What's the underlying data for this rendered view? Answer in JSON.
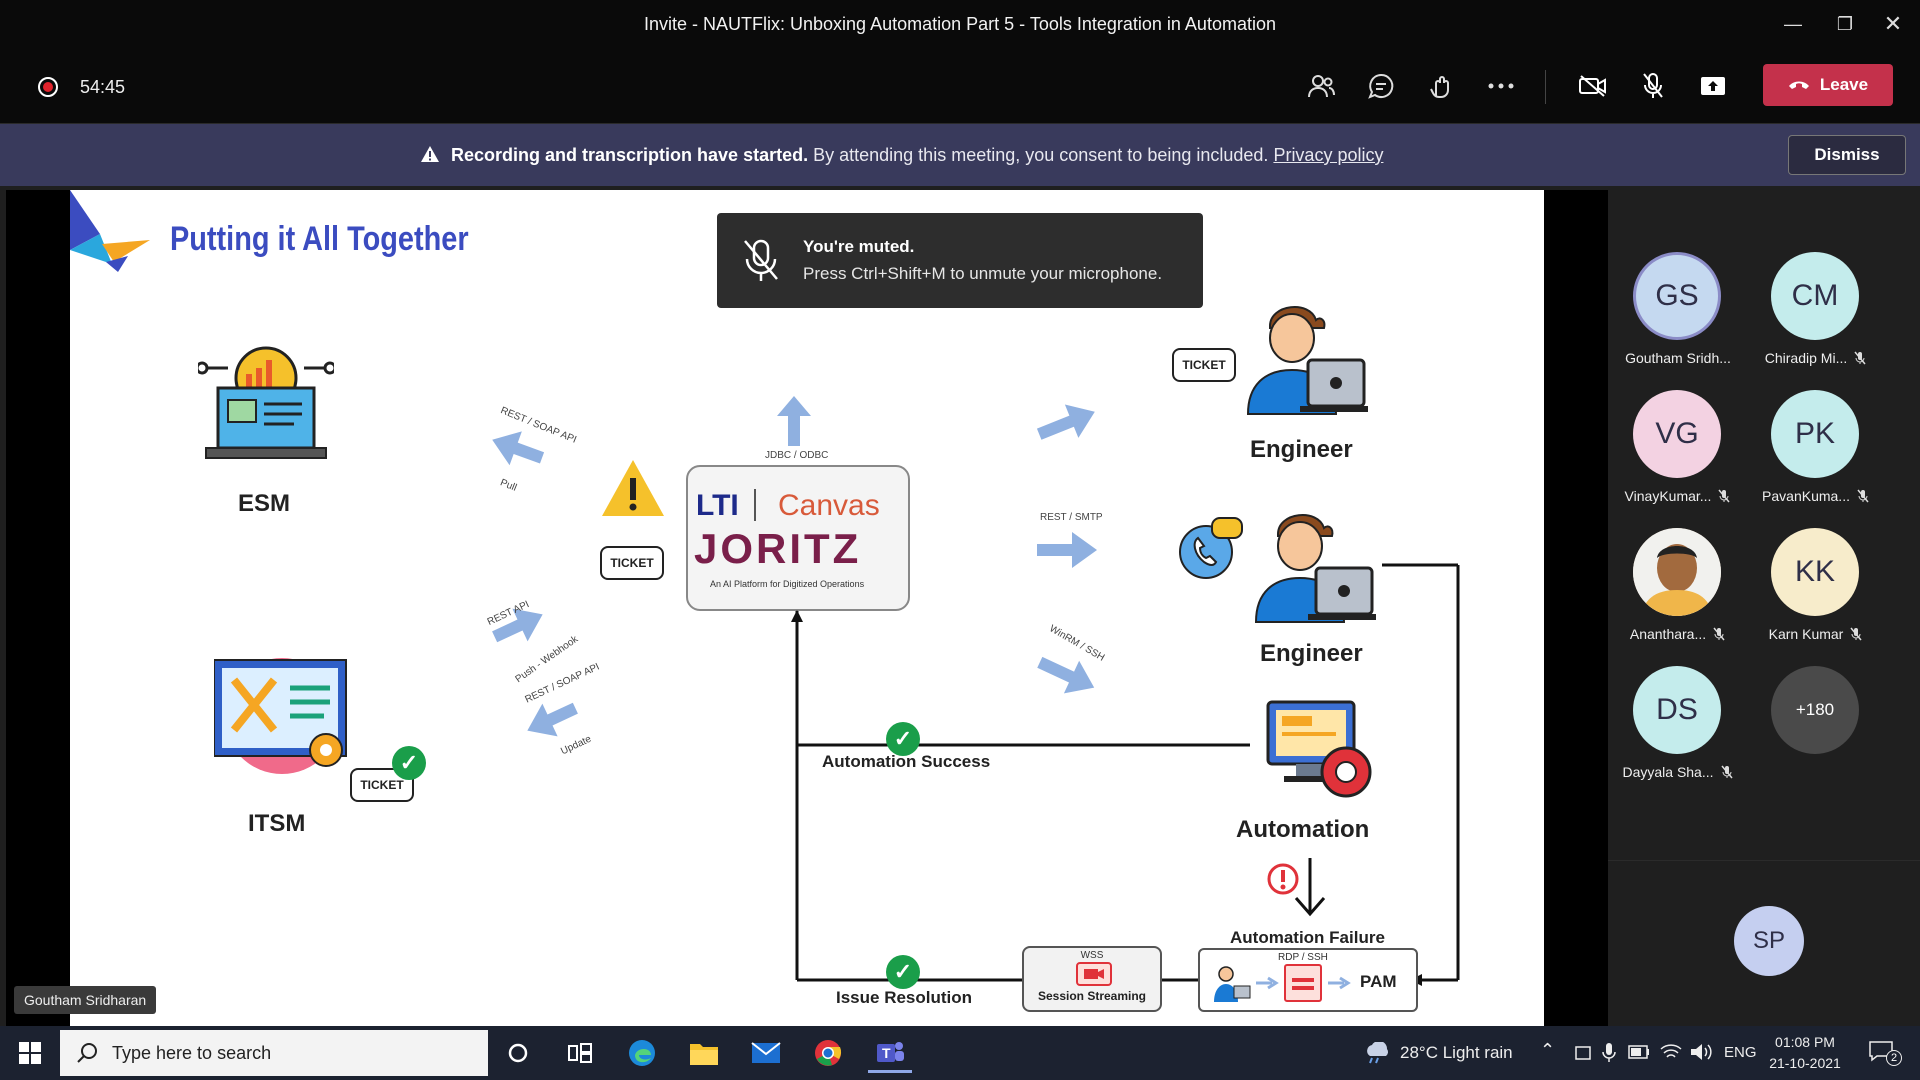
{
  "window": {
    "title": "Invite - NAUTFlix: Unboxing Automation Part 5 - Tools Integration in Automation"
  },
  "toolbar": {
    "timer": "54:45",
    "leave_label": "Leave"
  },
  "banner": {
    "bold_text": "Recording and transcription have started.",
    "text": "By attending this meeting, you consent to being included.",
    "link": "Privacy policy",
    "dismiss_label": "Dismiss"
  },
  "muted_toast": {
    "title": "You're muted.",
    "message": "Press Ctrl+Shift+M to unmute your microphone."
  },
  "slide": {
    "title": "Putting it All Together",
    "esm_label": "ESM",
    "itsm_label": "ITSM",
    "engineer1_label": "Engineer",
    "engineer2_label": "Engineer",
    "automation_label": "Automation",
    "automation_success": "Automation Success",
    "automation_failure": "Automation Failure",
    "issue_resolution": "Issue Resolution",
    "session_streaming": "Session Streaming",
    "pam_label": "PAM",
    "ticket": "TICKET",
    "proto_rest_soap_pull": "REST / SOAP API",
    "proto_pull": "Pull",
    "proto_jdbc": "JDBC / ODBC",
    "proto_rest_smtp": "REST / SMTP",
    "proto_winrm": "WinRM / SSH",
    "proto_rest_api": "REST API",
    "proto_push": "Push - Webhook",
    "proto_rest_soap_update": "REST / SOAP API",
    "proto_update": "Update",
    "proto_wss": "WSS",
    "proto_rdp": "RDP / SSH",
    "brand_lti": "LTI",
    "brand_canvas": "Canvas",
    "brand_joritz": "JORITZ",
    "brand_tagline": "An AI Platform for Digitized Operations"
  },
  "presenter": "Goutham Sridharan",
  "participants": [
    {
      "initials": "GS",
      "name": "Goutham Sridh...",
      "color": "#c5d9f0",
      "muted": false
    },
    {
      "initials": "CM",
      "name": "Chiradip Mi...",
      "color": "#c4ecec",
      "muted": true
    },
    {
      "initials": "VG",
      "name": "VinayKumar...",
      "color": "#f3d2e2",
      "muted": true
    },
    {
      "initials": "PK",
      "name": "PavanKuma...",
      "color": "#c4ecec",
      "muted": true
    },
    {
      "initials": "",
      "name": "Ananthara...",
      "color": "#e8c9a8",
      "muted": true
    },
    {
      "initials": "KK",
      "name": "Karn Kumar",
      "color": "#f7eccb",
      "muted": true
    },
    {
      "initials": "DS",
      "name": "Dayyala Sha...",
      "color": "#c4ecec",
      "muted": true
    },
    {
      "initials": "+180",
      "name": "",
      "color": "#4a4a4a",
      "muted": false
    }
  ],
  "self_avatar": {
    "initials": "SP",
    "color": "#c5cff0"
  },
  "taskbar": {
    "search_placeholder": "Type here to search",
    "weather": "28°C  Light rain",
    "lang": "ENG",
    "time": "01:08 PM",
    "date": "21-10-2021",
    "notification_count": "2"
  }
}
